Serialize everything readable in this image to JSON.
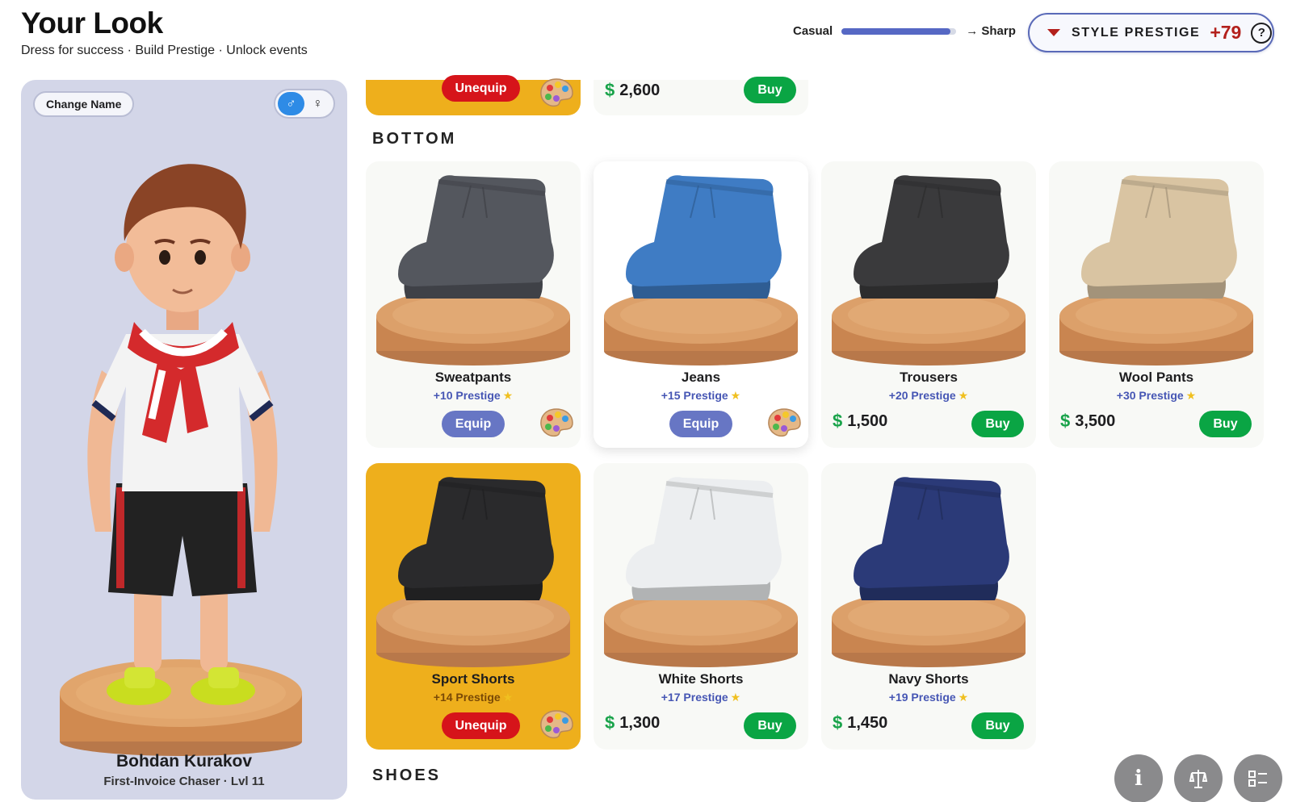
{
  "header": {
    "title": "Your Look",
    "subtitle": "Dress for success · Build Prestige · Unlock events",
    "style_slider": {
      "left_label": "Casual",
      "right_label": "→ Sharp",
      "value": 0.95
    },
    "prestige": {
      "label": "STYLE PRESTIGE",
      "value": "+79",
      "help": "?"
    }
  },
  "avatar": {
    "change_name_label": "Change Name",
    "gender": {
      "male_symbol": "♂",
      "female_symbol": "♀",
      "selected": "male"
    },
    "name": "Bohdan Kurakov",
    "subtitle": "First-Invoice Chaser · Lvl 11"
  },
  "top_partial": {
    "unequip_label": "Unequip",
    "price": "2,600",
    "buy_label": "Buy"
  },
  "sections": {
    "bottom": "BOTTOM",
    "shoes": "SHOES"
  },
  "items": [
    {
      "name": "Sweatpants",
      "prestige": "+10 Prestige",
      "state": "owned",
      "action": "Equip",
      "color": "#54575e"
    },
    {
      "name": "Jeans",
      "prestige": "+15 Prestige",
      "state": "owned",
      "action": "Equip",
      "color": "#3f7cc4"
    },
    {
      "name": "Trousers",
      "prestige": "+20 Prestige",
      "state": "shop",
      "price": "1,500",
      "action": "Buy",
      "color": "#3a3a3c"
    },
    {
      "name": "Wool Pants",
      "prestige": "+30 Prestige",
      "state": "shop",
      "price": "3,500",
      "action": "Buy",
      "color": "#d9c4a2"
    },
    {
      "name": "Sport Shorts",
      "prestige": "+14 Prestige",
      "state": "equipped",
      "action": "Unequip",
      "color": "#2a2a2c"
    },
    {
      "name": "White Shorts",
      "prestige": "+17 Prestige",
      "state": "shop",
      "price": "1,300",
      "action": "Buy",
      "color": "#eceef0"
    },
    {
      "name": "Navy Shorts",
      "prestige": "+19 Prestige",
      "state": "shop",
      "price": "1,450",
      "action": "Buy",
      "color": "#2b3a78"
    }
  ],
  "footer_buttons": {
    "info": "i"
  },
  "colors": {
    "equipped_bg": "#eeaf1c",
    "buy_green": "#0aa544",
    "equip_blue": "#5b6bc0",
    "unequip_red": "#d6141a",
    "prestige_red": "#b3201c"
  }
}
